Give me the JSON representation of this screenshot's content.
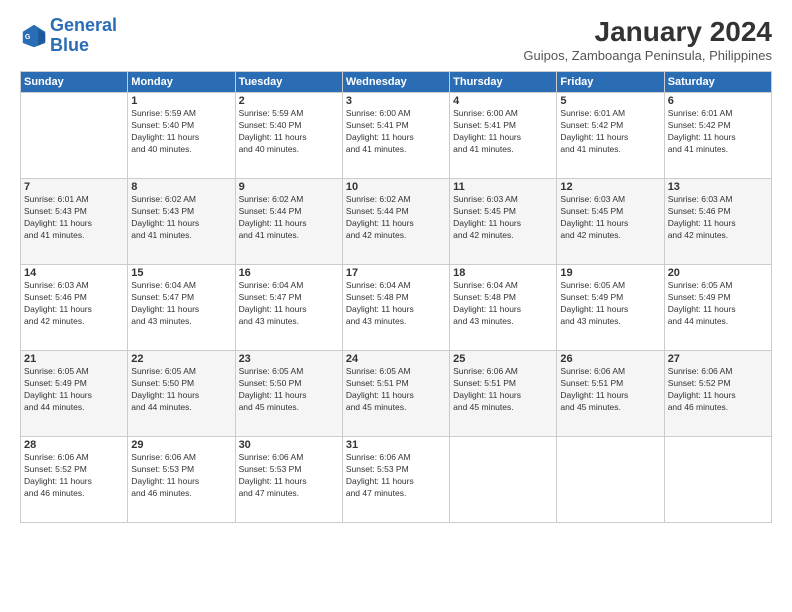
{
  "header": {
    "logo_line1": "General",
    "logo_line2": "Blue",
    "month": "January 2024",
    "location": "Guipos, Zamboanga Peninsula, Philippines"
  },
  "weekdays": [
    "Sunday",
    "Monday",
    "Tuesday",
    "Wednesday",
    "Thursday",
    "Friday",
    "Saturday"
  ],
  "weeks": [
    [
      {
        "day": "",
        "info": ""
      },
      {
        "day": "1",
        "info": "Sunrise: 5:59 AM\nSunset: 5:40 PM\nDaylight: 11 hours\nand 40 minutes."
      },
      {
        "day": "2",
        "info": "Sunrise: 5:59 AM\nSunset: 5:40 PM\nDaylight: 11 hours\nand 40 minutes."
      },
      {
        "day": "3",
        "info": "Sunrise: 6:00 AM\nSunset: 5:41 PM\nDaylight: 11 hours\nand 41 minutes."
      },
      {
        "day": "4",
        "info": "Sunrise: 6:00 AM\nSunset: 5:41 PM\nDaylight: 11 hours\nand 41 minutes."
      },
      {
        "day": "5",
        "info": "Sunrise: 6:01 AM\nSunset: 5:42 PM\nDaylight: 11 hours\nand 41 minutes."
      },
      {
        "day": "6",
        "info": "Sunrise: 6:01 AM\nSunset: 5:42 PM\nDaylight: 11 hours\nand 41 minutes."
      }
    ],
    [
      {
        "day": "7",
        "info": "Sunrise: 6:01 AM\nSunset: 5:43 PM\nDaylight: 11 hours\nand 41 minutes."
      },
      {
        "day": "8",
        "info": "Sunrise: 6:02 AM\nSunset: 5:43 PM\nDaylight: 11 hours\nand 41 minutes."
      },
      {
        "day": "9",
        "info": "Sunrise: 6:02 AM\nSunset: 5:44 PM\nDaylight: 11 hours\nand 41 minutes."
      },
      {
        "day": "10",
        "info": "Sunrise: 6:02 AM\nSunset: 5:44 PM\nDaylight: 11 hours\nand 42 minutes."
      },
      {
        "day": "11",
        "info": "Sunrise: 6:03 AM\nSunset: 5:45 PM\nDaylight: 11 hours\nand 42 minutes."
      },
      {
        "day": "12",
        "info": "Sunrise: 6:03 AM\nSunset: 5:45 PM\nDaylight: 11 hours\nand 42 minutes."
      },
      {
        "day": "13",
        "info": "Sunrise: 6:03 AM\nSunset: 5:46 PM\nDaylight: 11 hours\nand 42 minutes."
      }
    ],
    [
      {
        "day": "14",
        "info": "Sunrise: 6:03 AM\nSunset: 5:46 PM\nDaylight: 11 hours\nand 42 minutes."
      },
      {
        "day": "15",
        "info": "Sunrise: 6:04 AM\nSunset: 5:47 PM\nDaylight: 11 hours\nand 43 minutes."
      },
      {
        "day": "16",
        "info": "Sunrise: 6:04 AM\nSunset: 5:47 PM\nDaylight: 11 hours\nand 43 minutes."
      },
      {
        "day": "17",
        "info": "Sunrise: 6:04 AM\nSunset: 5:48 PM\nDaylight: 11 hours\nand 43 minutes."
      },
      {
        "day": "18",
        "info": "Sunrise: 6:04 AM\nSunset: 5:48 PM\nDaylight: 11 hours\nand 43 minutes."
      },
      {
        "day": "19",
        "info": "Sunrise: 6:05 AM\nSunset: 5:49 PM\nDaylight: 11 hours\nand 43 minutes."
      },
      {
        "day": "20",
        "info": "Sunrise: 6:05 AM\nSunset: 5:49 PM\nDaylight: 11 hours\nand 44 minutes."
      }
    ],
    [
      {
        "day": "21",
        "info": "Sunrise: 6:05 AM\nSunset: 5:49 PM\nDaylight: 11 hours\nand 44 minutes."
      },
      {
        "day": "22",
        "info": "Sunrise: 6:05 AM\nSunset: 5:50 PM\nDaylight: 11 hours\nand 44 minutes."
      },
      {
        "day": "23",
        "info": "Sunrise: 6:05 AM\nSunset: 5:50 PM\nDaylight: 11 hours\nand 45 minutes."
      },
      {
        "day": "24",
        "info": "Sunrise: 6:05 AM\nSunset: 5:51 PM\nDaylight: 11 hours\nand 45 minutes."
      },
      {
        "day": "25",
        "info": "Sunrise: 6:06 AM\nSunset: 5:51 PM\nDaylight: 11 hours\nand 45 minutes."
      },
      {
        "day": "26",
        "info": "Sunrise: 6:06 AM\nSunset: 5:51 PM\nDaylight: 11 hours\nand 45 minutes."
      },
      {
        "day": "27",
        "info": "Sunrise: 6:06 AM\nSunset: 5:52 PM\nDaylight: 11 hours\nand 46 minutes."
      }
    ],
    [
      {
        "day": "28",
        "info": "Sunrise: 6:06 AM\nSunset: 5:52 PM\nDaylight: 11 hours\nand 46 minutes."
      },
      {
        "day": "29",
        "info": "Sunrise: 6:06 AM\nSunset: 5:53 PM\nDaylight: 11 hours\nand 46 minutes."
      },
      {
        "day": "30",
        "info": "Sunrise: 6:06 AM\nSunset: 5:53 PM\nDaylight: 11 hours\nand 47 minutes."
      },
      {
        "day": "31",
        "info": "Sunrise: 6:06 AM\nSunset: 5:53 PM\nDaylight: 11 hours\nand 47 minutes."
      },
      {
        "day": "",
        "info": ""
      },
      {
        "day": "",
        "info": ""
      },
      {
        "day": "",
        "info": ""
      }
    ]
  ]
}
